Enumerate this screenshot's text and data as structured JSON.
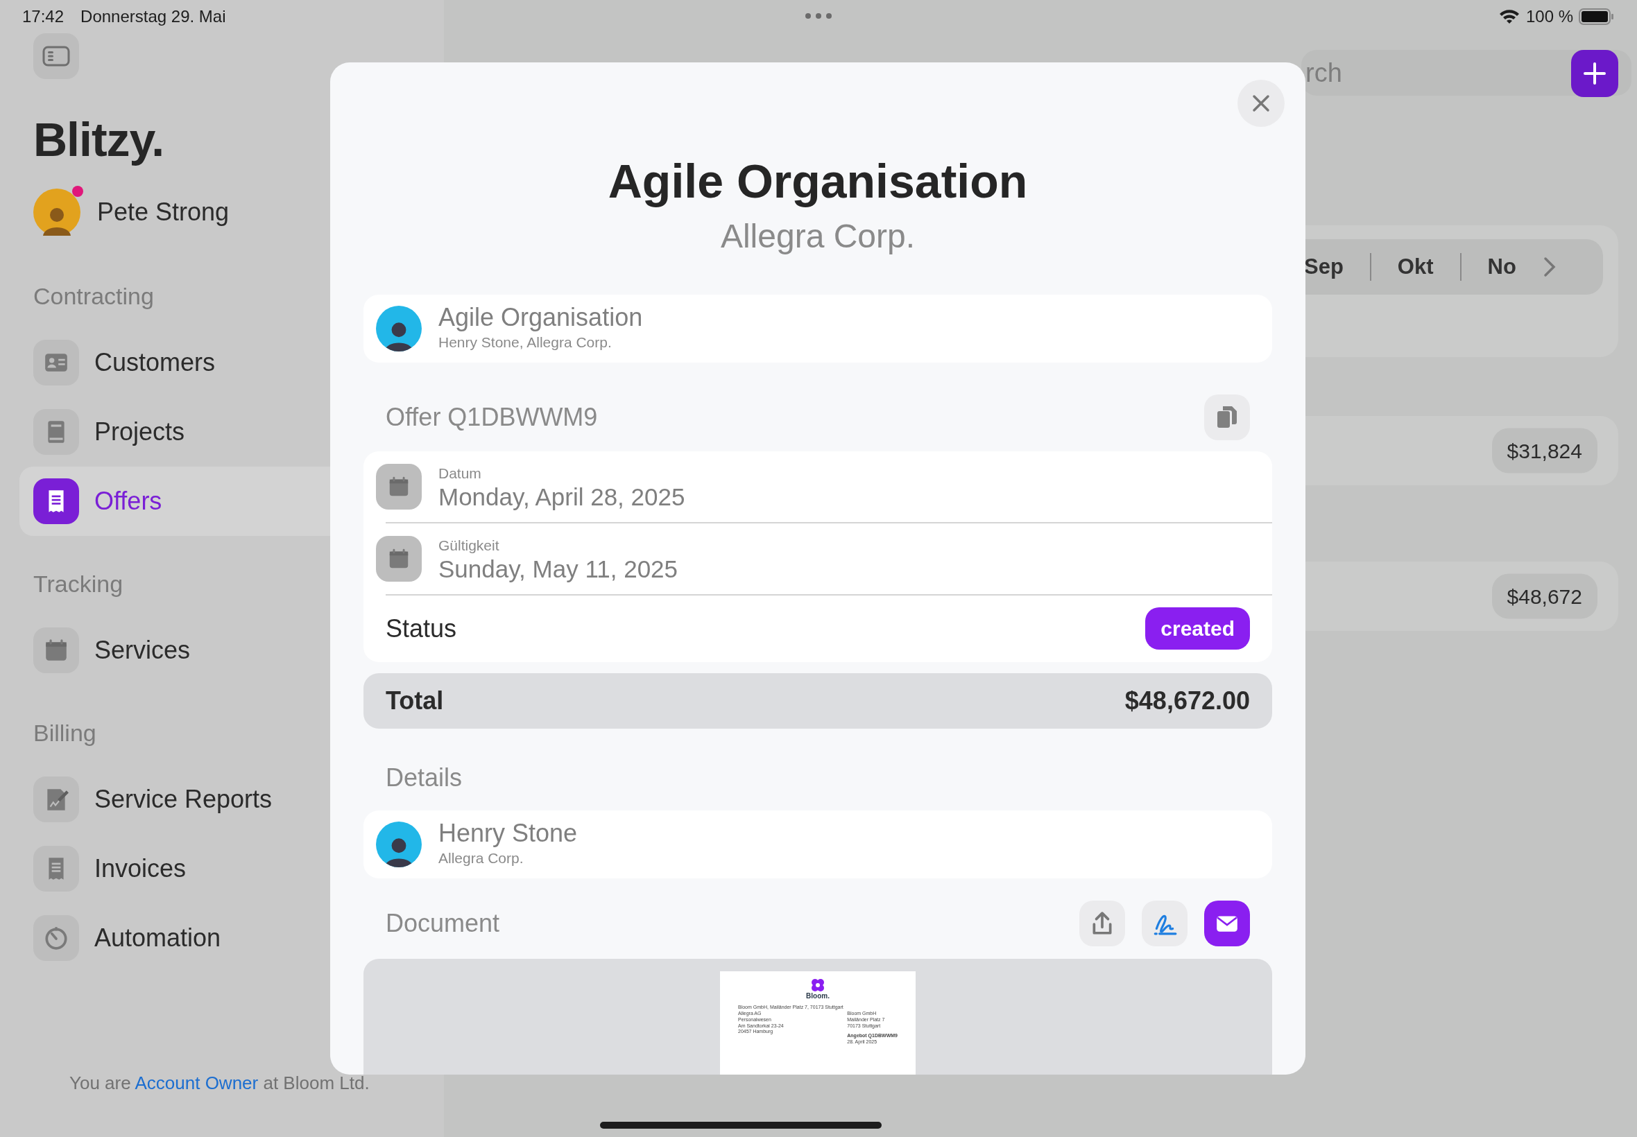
{
  "status_bar": {
    "time": "17:42",
    "date": "Donnerstag 29. Mai",
    "battery": "100 %"
  },
  "sidebar": {
    "app_title": "Blitzy.",
    "user": {
      "name": "Pete Strong",
      "notification": true
    },
    "sections": [
      {
        "title": "Contracting",
        "items": [
          {
            "label": "Customers",
            "selected": false
          },
          {
            "label": "Projects",
            "selected": false
          },
          {
            "label": "Offers",
            "selected": true
          }
        ]
      },
      {
        "title": "Tracking",
        "items": [
          {
            "label": "Services",
            "selected": false
          }
        ]
      },
      {
        "title": "Billing",
        "items": [
          {
            "label": "Service Reports",
            "selected": false
          },
          {
            "label": "Invoices",
            "selected": false
          },
          {
            "label": "Automation",
            "selected": false
          }
        ]
      }
    ],
    "footer": {
      "prefix": "You are",
      "role": "Account Owner",
      "suffix": "at Bloom Ltd."
    }
  },
  "background": {
    "search": {
      "placeholder": "rch"
    },
    "months": [
      "Sep",
      "Okt",
      "No"
    ],
    "amounts": [
      "$31,824",
      "$48,672"
    ]
  },
  "modal": {
    "title": "Agile Organisation",
    "subtitle": "Allegra Corp.",
    "project": {
      "title": "Agile Organisation",
      "subtitle": "Henry Stone, Allegra Corp."
    },
    "offer_heading": "Offer Q1DBWWM9",
    "dates": [
      {
        "label": "Datum",
        "value": "Monday, April 28, 2025"
      },
      {
        "label": "Gültigkeit",
        "value": "Sunday, May 11, 2025"
      }
    ],
    "status": {
      "label": "Status",
      "value": "created"
    },
    "total": {
      "label": "Total",
      "value": "$48,672.00"
    },
    "details_heading": "Details",
    "contact": {
      "name": "Henry Stone",
      "company": "Allegra Corp."
    },
    "document_heading": "Document",
    "document_actions": [
      {
        "kind": "share",
        "primary": false
      },
      {
        "kind": "sign",
        "primary": false
      },
      {
        "kind": "mail",
        "primary": true
      }
    ],
    "document_preview": {
      "logo": "Bloom.",
      "sender_line": "Bloom GmbH, Mailänder Platz 7, 70173 Stuttgart",
      "recipient": [
        "Allegra AG",
        "Personalwesen",
        "Am Sandtorkai 23-24",
        "20457 Hamburg"
      ],
      "sender": [
        "Bloom GmbH",
        "Mailänder Platz 7",
        "70173 Stuttgart"
      ],
      "offer": "Angebot Q1DBWWM9",
      "date": "28. April 2025"
    }
  }
}
